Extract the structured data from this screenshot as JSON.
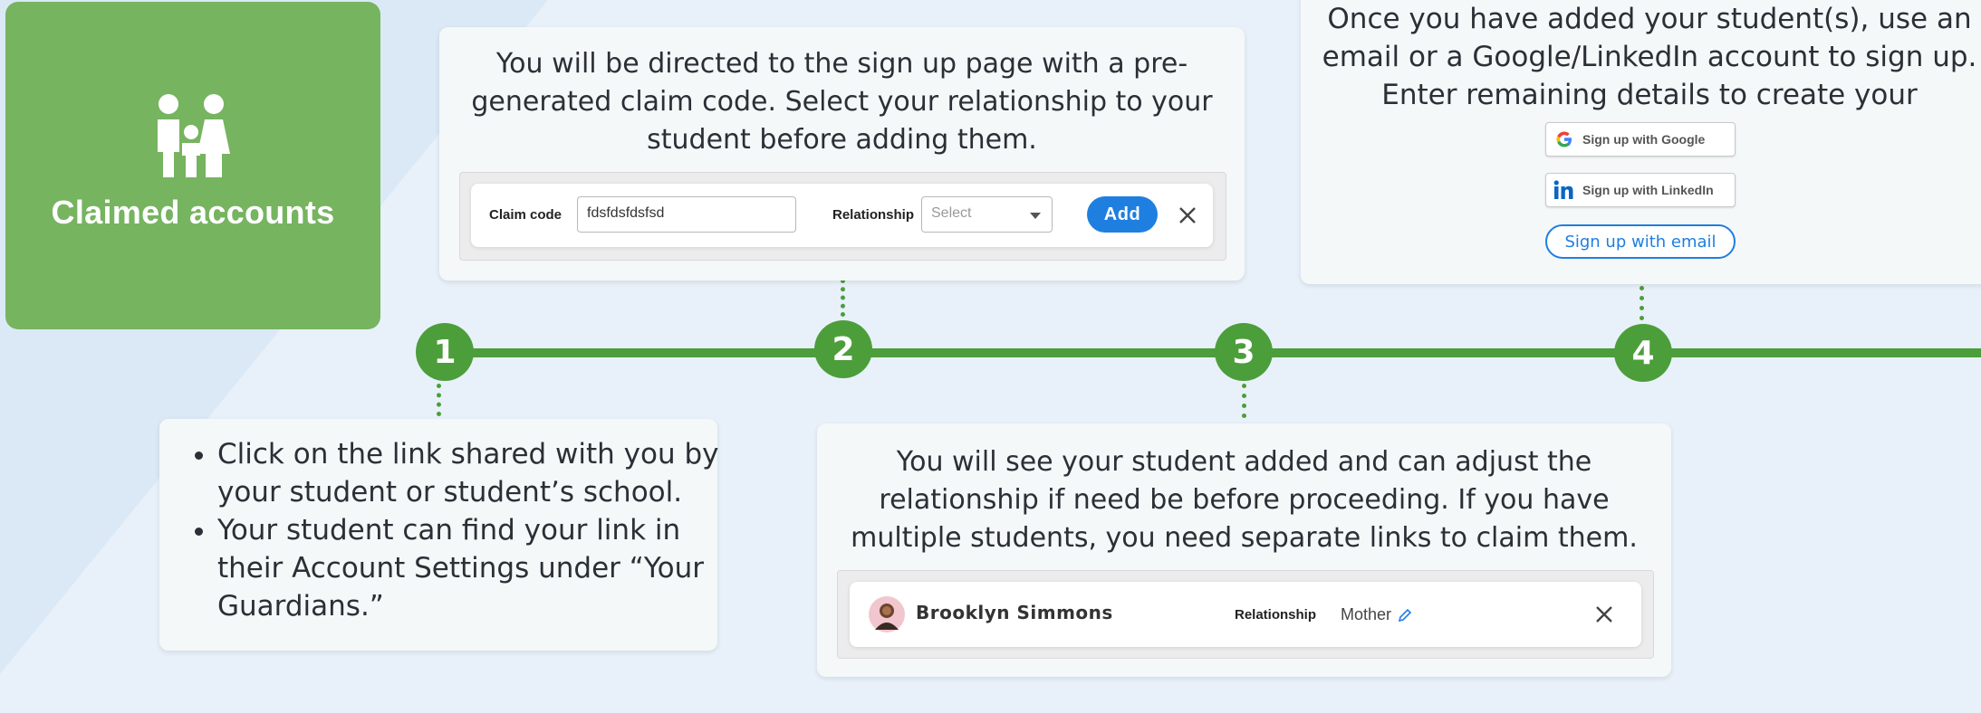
{
  "hero": {
    "title": "Claimed accounts",
    "icon": "family-icon",
    "color": "#76b460"
  },
  "timeline": {
    "color": "#4c9e3b",
    "steps": [
      "1",
      "2",
      "3",
      "4"
    ]
  },
  "step1": {
    "bullets": [
      "Click on the link shared with you by your student or student’s school.",
      "Your student can find your link in their Account Settings under “Your Guardians.”"
    ]
  },
  "step2": {
    "text": "You will be directed to the sign up page with a pre-generated claim code. Select your relationship to your student before adding them.",
    "form": {
      "claim_code_label": "Claim code",
      "claim_code_value": "fdsfdsfdsfsd",
      "relationship_label": "Relationship",
      "relationship_placeholder": "Select",
      "add_label": "Add",
      "close_icon": "close-icon"
    }
  },
  "step3": {
    "text": "You will see your student added and can adjust the relationship if need be before proceeding. If you have multiple students, you need separate links to claim them.",
    "student": {
      "name": "Brooklyn Simmons",
      "relationship_label": "Relationship",
      "relationship_value": "Mother",
      "edit_icon": "pencil-icon",
      "remove_icon": "close-icon"
    }
  },
  "step4": {
    "text": "Once you have added your student(s), use an email or a Google/LinkedIn account to sign up. Enter remaining details to create your account.",
    "google_label": "Sign up with Google",
    "linkedin_label": "Sign up with LinkedIn",
    "email_label": "Sign up with email"
  },
  "colors": {
    "accent_blue": "#1e7fe0",
    "background": "#e8f1fa"
  }
}
